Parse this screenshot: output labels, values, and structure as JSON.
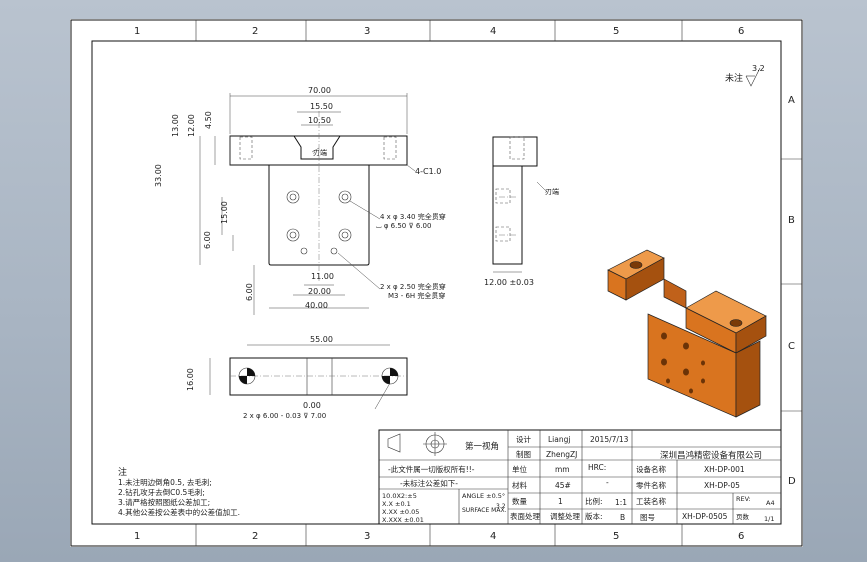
{
  "frame": {
    "col_markers": [
      "1",
      "2",
      "3",
      "4",
      "5",
      "6"
    ],
    "row_markers": [
      "A",
      "B",
      "C",
      "D"
    ]
  },
  "surface": {
    "symbol": "3.2",
    "label": "未注"
  },
  "front_dims": {
    "w70": "70.00",
    "w15_50": "15.50",
    "w10_50": "10.50",
    "h13": "13.00",
    "h12": "12.00",
    "h4_50": "4.50",
    "h33": "33.00",
    "chamfer": "4-C1.0",
    "hole_note_1a": "4 x φ 3.40 完全贯穿",
    "hole_note_1b": "⌴ φ 6.50 ⊽ 6.00",
    "v15": "15.00",
    "v6a": "6.00",
    "v6b": "6.00",
    "w11": "11.00",
    "w20": "20.00",
    "w40": "40.00",
    "hole_note_2a": "2 x φ 2.50 完全贯穿",
    "hole_note_2b": "M3 - 6H 完全贯穿",
    "edge_label": "刃端"
  },
  "side_dims": {
    "w12": "12.00 ±0.03",
    "edge_label": "刃端"
  },
  "bottom_dims": {
    "w55": "55.00",
    "h16": "16.00",
    "pin_a": "0.00",
    "pin_b": "2 x φ 6.00 - 0.03 ⊽ 7.00"
  },
  "notes": {
    "heading": "注",
    "items": [
      "1.未注明边倒角0.5, 去毛刺;",
      "2.钻孔攻牙去倒C0.5毛刺;",
      "3.请严格按照图纸公差加工;",
      "4.其他公差按公差表中的公差值加工."
    ]
  },
  "title_block": {
    "projection": "第一视角",
    "warning": "-此文件属一切版权所有!!-",
    "tolerance_title": "-未标注公差如下-",
    "tol_rows": [
      "10.0X2:±5",
      "X.X  ±0.1",
      "X.XX ±0.05",
      "X.XXX ±0.01"
    ],
    "tol_angle": "ANGLE  ±0.5°",
    "tol_unit": "3.2",
    "tol_unit_label": "SURFACE MAX.",
    "design_label": "设计",
    "designer": "Liangj",
    "date": "2015/7/13",
    "draw_label": "制图",
    "drawer": "ZhengZJ",
    "unit_label": "单位",
    "unit": "mm",
    "hrc_label": "HRC:",
    "hrc": "-",
    "material_label": "材料",
    "material": "45#",
    "qty_label": "数量",
    "qty": "1",
    "scale_label": "比例:",
    "scale": "1:1",
    "surface_label": "表面处理",
    "surface_val": "调整处理",
    "version_label": "版本:",
    "version": "B",
    "company": "深圳昌鸿精密设备有限公司",
    "equip_name_label": "设备名称",
    "equip_name": "XH-DP-001",
    "part_name_label": "零件名称",
    "part_name": "XH-DP-05",
    "station_label": "工装名称",
    "drawing_no_label": "图号",
    "drawing_no": "XH-DP-0505",
    "rev_label": "REV:",
    "rev": "A4",
    "sheet_label": "页数",
    "sheet": "1/1"
  },
  "colors": {
    "part_fill": "#d9741f",
    "part_dark": "#a5510f",
    "part_light": "#ee9a4a"
  }
}
